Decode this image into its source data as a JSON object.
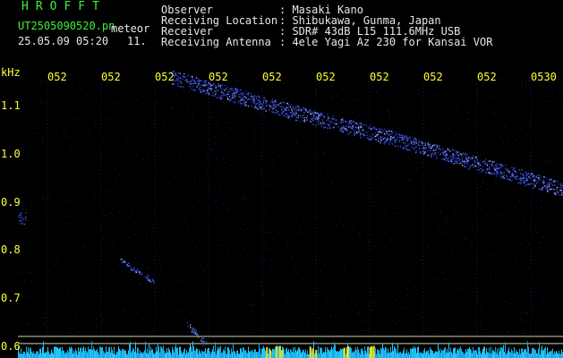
{
  "header": {
    "logo": "HROFFT",
    "filename": "UT2505090520.pn",
    "tag": "meteor",
    "datetime": "25.05.09 05:20",
    "index": "11.",
    "labels": {
      "observer": "Observer",
      "location": "Receiving Location",
      "receiver": "Receiver",
      "antenna": "Receiving Antenna"
    },
    "values": {
      "observer": ": Masaki Kano",
      "location": ": Shibukawa, Gunma, Japan",
      "receiver": ": SDR# 43dB L15 111.6MHz USB",
      "antenna": ": 4ele Yagi Az 230 for Kansai VOR"
    }
  },
  "colors": {
    "background": "#000000",
    "header_green": "#3cf03c",
    "axis_yellow": "#ffff33",
    "signal_blue": "#3a5cff",
    "noise_cyan": "#20d0ff"
  },
  "chart_data": {
    "type": "heatmap",
    "ylabel": "kHz",
    "x_ticks": [
      "052",
      "052",
      "052",
      "052",
      "052",
      "052",
      "052",
      "052",
      "052",
      "0530"
    ],
    "y_ticks": [
      "1.1",
      "1.0",
      "0.9",
      "0.8",
      "0.7",
      "0.6"
    ],
    "ylim": [
      0.59,
      1.16
    ],
    "reference_lines_khz": [
      0.62,
      0.605
    ],
    "echo_traces": [
      {
        "points": [
          [
            2.3,
            1.16
          ],
          [
            4.5,
            1.09
          ],
          [
            6.5,
            1.03
          ],
          [
            9.8,
            0.92
          ]
        ]
      },
      {
        "points": [
          [
            1.35,
            0.78
          ],
          [
            1.95,
            0.735
          ]
        ]
      },
      {
        "points": [
          [
            2.6,
            0.645
          ],
          [
            2.95,
            0.605
          ]
        ]
      }
    ]
  }
}
